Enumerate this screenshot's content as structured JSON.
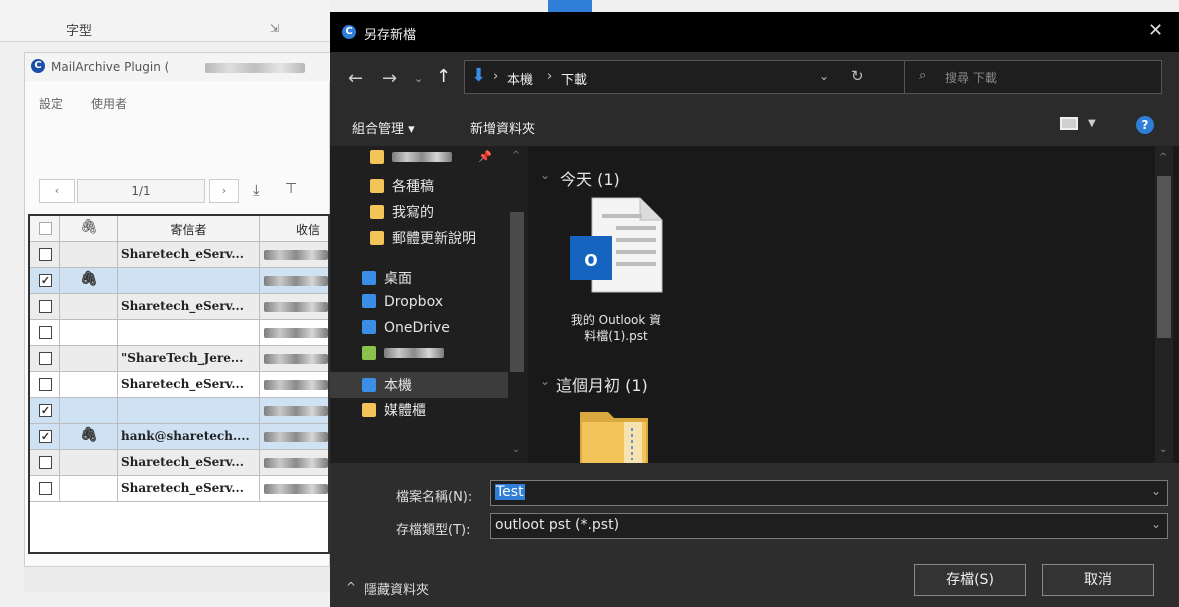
{
  "background": {
    "ribbon_label": "字型",
    "plugin_title": "MailArchive Plugin (",
    "menu": [
      "設定",
      "使用者"
    ],
    "pager_text": "1/1",
    "columns": [
      "寄信者",
      "收信"
    ],
    "rows": [
      {
        "checked": false,
        "attach": false,
        "sender": "Sharetech_eServ..."
      },
      {
        "checked": true,
        "attach": true,
        "sender": ""
      },
      {
        "checked": false,
        "attach": false,
        "sender": "Sharetech_eServ..."
      },
      {
        "checked": false,
        "attach": false,
        "sender": ""
      },
      {
        "checked": false,
        "attach": false,
        "sender": "\"ShareTech_Jere..."
      },
      {
        "checked": false,
        "attach": false,
        "sender": "Sharetech_eServ..."
      },
      {
        "checked": true,
        "attach": false,
        "sender": ""
      },
      {
        "checked": true,
        "attach": true,
        "sender": "hank@sharetech...."
      },
      {
        "checked": false,
        "attach": false,
        "sender": "Sharetech_eServ..."
      },
      {
        "checked": false,
        "attach": false,
        "sender": "Sharetech_eServ..."
      }
    ]
  },
  "dialog": {
    "title": "另存新檔",
    "breadcrumb": [
      "本機",
      "下載"
    ],
    "search_placeholder": "搜尋 下載",
    "toolbar": {
      "organize": "組合管理 ▾",
      "new_folder": "新增資料夾"
    },
    "nav_items": [
      "",
      "各種稿",
      "我寫的",
      "郵體更新說明",
      "桌面",
      "Dropbox",
      "OneDrive",
      "",
      "本機",
      "媒體櫃"
    ],
    "groups": [
      {
        "label": "今天 (1)",
        "files": [
          {
            "name_line1": "我的 Outlook 資",
            "name_line2": "料檔(1).pst"
          }
        ]
      },
      {
        "label": "這個月初 (1)"
      }
    ],
    "filename_label": "檔案名稱(N):",
    "filename_value": "Test",
    "filetype_label": "存檔類型(T):",
    "filetype_value": "outloot pst (*.pst)",
    "hide_folders": "隱藏資料夾",
    "save_button": "存檔(S)",
    "cancel_button": "取消",
    "colors": {
      "accent": "#2f7ed8",
      "dialog_bg": "#2b2b2b",
      "titlebar": "#000000"
    }
  }
}
